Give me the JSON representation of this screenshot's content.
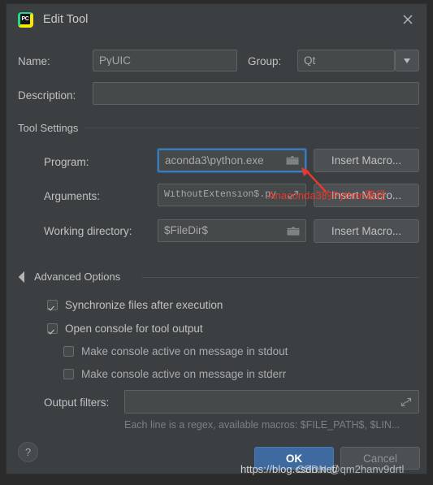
{
  "window": {
    "title": "Edit Tool",
    "app_icon": "pycharm-icon",
    "icon_letters": "PC",
    "close_icon": "close-icon"
  },
  "form": {
    "name_label": "Name:",
    "name_value": "PyUIC",
    "group_label": "Group:",
    "group_value": "Qt",
    "group_dropdown_icon": "chevron-down-icon",
    "description_label": "Description:",
    "description_value": "",
    "description_placeholder": ""
  },
  "tool_settings": {
    "section_label": "Tool Settings",
    "program_label": "Program:",
    "program_value": "aconda3\\python.exe",
    "program_browse_icon": "folder-icon",
    "program_insert_macro": "Insert Macro...",
    "arguments_label": "Arguments:",
    "arguments_value": "WithoutExtension$.py",
    "arguments_expand_icon": "expand-icon",
    "arguments_insert_macro": "Insert Macro...",
    "working_dir_label": "Working directory:",
    "working_dir_value": "$FileDir$",
    "working_dir_browse_icon": "folder-icon",
    "working_dir_insert_macro": "Insert Macro..."
  },
  "advanced_options": {
    "section_label": "Advanced Options",
    "expanded": true,
    "expander_icon": "triangle-down-icon",
    "checkboxes": [
      {
        "label": "Synchronize files after execution",
        "checked": true,
        "indent": 0
      },
      {
        "label": "Open console for tool output",
        "checked": true,
        "indent": 0
      },
      {
        "label": "Make console active on message in stdout",
        "checked": false,
        "indent": 1
      },
      {
        "label": "Make console active on message in stderr",
        "checked": false,
        "indent": 1
      }
    ],
    "output_filters_label": "Output filters:",
    "output_filters_value": "",
    "output_filters_expand_icon": "expand-icon",
    "output_filters_hint": "Each line is a regex, available macros: $FILE_PATH$, $LIN..."
  },
  "footer": {
    "help_label": "?",
    "ok_label": "OK",
    "cancel_label": "Cancel"
  },
  "annotation": {
    "text": "Anaconda3的Python路径",
    "arrow_icon": "arrow-up-left-icon",
    "color": "#e8392e"
  },
  "watermark": {
    "line1": "https://blog.csdn.net/",
    "line2": "CSDN @qm2hanv9drtl"
  },
  "colors": {
    "dialog_bg": "#3c3f41",
    "field_bg": "#45494a",
    "accent_focus": "#3e7bb6",
    "primary_button": "#3f6aa0",
    "annotation_red": "#e8392e"
  }
}
